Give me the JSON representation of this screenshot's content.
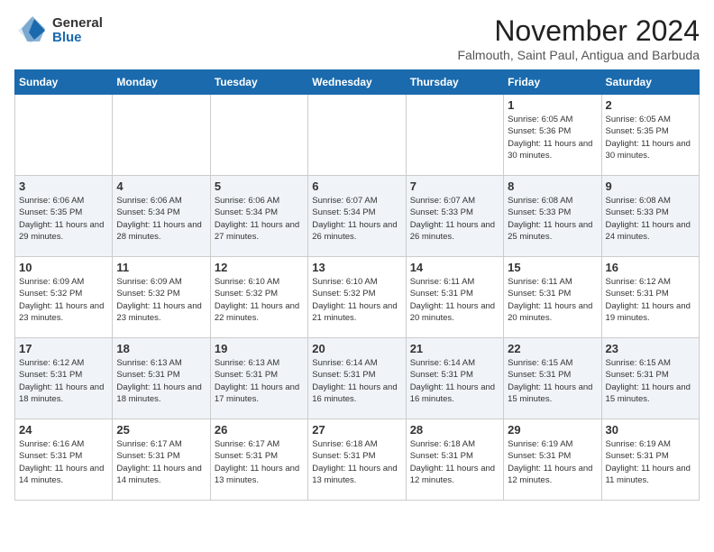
{
  "logo": {
    "general": "General",
    "blue": "Blue"
  },
  "title": "November 2024",
  "subtitle": "Falmouth, Saint Paul, Antigua and Barbuda",
  "headers": [
    "Sunday",
    "Monday",
    "Tuesday",
    "Wednesday",
    "Thursday",
    "Friday",
    "Saturday"
  ],
  "weeks": [
    [
      {
        "day": "",
        "info": ""
      },
      {
        "day": "",
        "info": ""
      },
      {
        "day": "",
        "info": ""
      },
      {
        "day": "",
        "info": ""
      },
      {
        "day": "",
        "info": ""
      },
      {
        "day": "1",
        "info": "Sunrise: 6:05 AM\nSunset: 5:36 PM\nDaylight: 11 hours and 30 minutes."
      },
      {
        "day": "2",
        "info": "Sunrise: 6:05 AM\nSunset: 5:35 PM\nDaylight: 11 hours and 30 minutes."
      }
    ],
    [
      {
        "day": "3",
        "info": "Sunrise: 6:06 AM\nSunset: 5:35 PM\nDaylight: 11 hours and 29 minutes."
      },
      {
        "day": "4",
        "info": "Sunrise: 6:06 AM\nSunset: 5:34 PM\nDaylight: 11 hours and 28 minutes."
      },
      {
        "day": "5",
        "info": "Sunrise: 6:06 AM\nSunset: 5:34 PM\nDaylight: 11 hours and 27 minutes."
      },
      {
        "day": "6",
        "info": "Sunrise: 6:07 AM\nSunset: 5:34 PM\nDaylight: 11 hours and 26 minutes."
      },
      {
        "day": "7",
        "info": "Sunrise: 6:07 AM\nSunset: 5:33 PM\nDaylight: 11 hours and 26 minutes."
      },
      {
        "day": "8",
        "info": "Sunrise: 6:08 AM\nSunset: 5:33 PM\nDaylight: 11 hours and 25 minutes."
      },
      {
        "day": "9",
        "info": "Sunrise: 6:08 AM\nSunset: 5:33 PM\nDaylight: 11 hours and 24 minutes."
      }
    ],
    [
      {
        "day": "10",
        "info": "Sunrise: 6:09 AM\nSunset: 5:32 PM\nDaylight: 11 hours and 23 minutes."
      },
      {
        "day": "11",
        "info": "Sunrise: 6:09 AM\nSunset: 5:32 PM\nDaylight: 11 hours and 23 minutes."
      },
      {
        "day": "12",
        "info": "Sunrise: 6:10 AM\nSunset: 5:32 PM\nDaylight: 11 hours and 22 minutes."
      },
      {
        "day": "13",
        "info": "Sunrise: 6:10 AM\nSunset: 5:32 PM\nDaylight: 11 hours and 21 minutes."
      },
      {
        "day": "14",
        "info": "Sunrise: 6:11 AM\nSunset: 5:31 PM\nDaylight: 11 hours and 20 minutes."
      },
      {
        "day": "15",
        "info": "Sunrise: 6:11 AM\nSunset: 5:31 PM\nDaylight: 11 hours and 20 minutes."
      },
      {
        "day": "16",
        "info": "Sunrise: 6:12 AM\nSunset: 5:31 PM\nDaylight: 11 hours and 19 minutes."
      }
    ],
    [
      {
        "day": "17",
        "info": "Sunrise: 6:12 AM\nSunset: 5:31 PM\nDaylight: 11 hours and 18 minutes."
      },
      {
        "day": "18",
        "info": "Sunrise: 6:13 AM\nSunset: 5:31 PM\nDaylight: 11 hours and 18 minutes."
      },
      {
        "day": "19",
        "info": "Sunrise: 6:13 AM\nSunset: 5:31 PM\nDaylight: 11 hours and 17 minutes."
      },
      {
        "day": "20",
        "info": "Sunrise: 6:14 AM\nSunset: 5:31 PM\nDaylight: 11 hours and 16 minutes."
      },
      {
        "day": "21",
        "info": "Sunrise: 6:14 AM\nSunset: 5:31 PM\nDaylight: 11 hours and 16 minutes."
      },
      {
        "day": "22",
        "info": "Sunrise: 6:15 AM\nSunset: 5:31 PM\nDaylight: 11 hours and 15 minutes."
      },
      {
        "day": "23",
        "info": "Sunrise: 6:15 AM\nSunset: 5:31 PM\nDaylight: 11 hours and 15 minutes."
      }
    ],
    [
      {
        "day": "24",
        "info": "Sunrise: 6:16 AM\nSunset: 5:31 PM\nDaylight: 11 hours and 14 minutes."
      },
      {
        "day": "25",
        "info": "Sunrise: 6:17 AM\nSunset: 5:31 PM\nDaylight: 11 hours and 14 minutes."
      },
      {
        "day": "26",
        "info": "Sunrise: 6:17 AM\nSunset: 5:31 PM\nDaylight: 11 hours and 13 minutes."
      },
      {
        "day": "27",
        "info": "Sunrise: 6:18 AM\nSunset: 5:31 PM\nDaylight: 11 hours and 13 minutes."
      },
      {
        "day": "28",
        "info": "Sunrise: 6:18 AM\nSunset: 5:31 PM\nDaylight: 11 hours and 12 minutes."
      },
      {
        "day": "29",
        "info": "Sunrise: 6:19 AM\nSunset: 5:31 PM\nDaylight: 11 hours and 12 minutes."
      },
      {
        "day": "30",
        "info": "Sunrise: 6:19 AM\nSunset: 5:31 PM\nDaylight: 11 hours and 11 minutes."
      }
    ]
  ]
}
